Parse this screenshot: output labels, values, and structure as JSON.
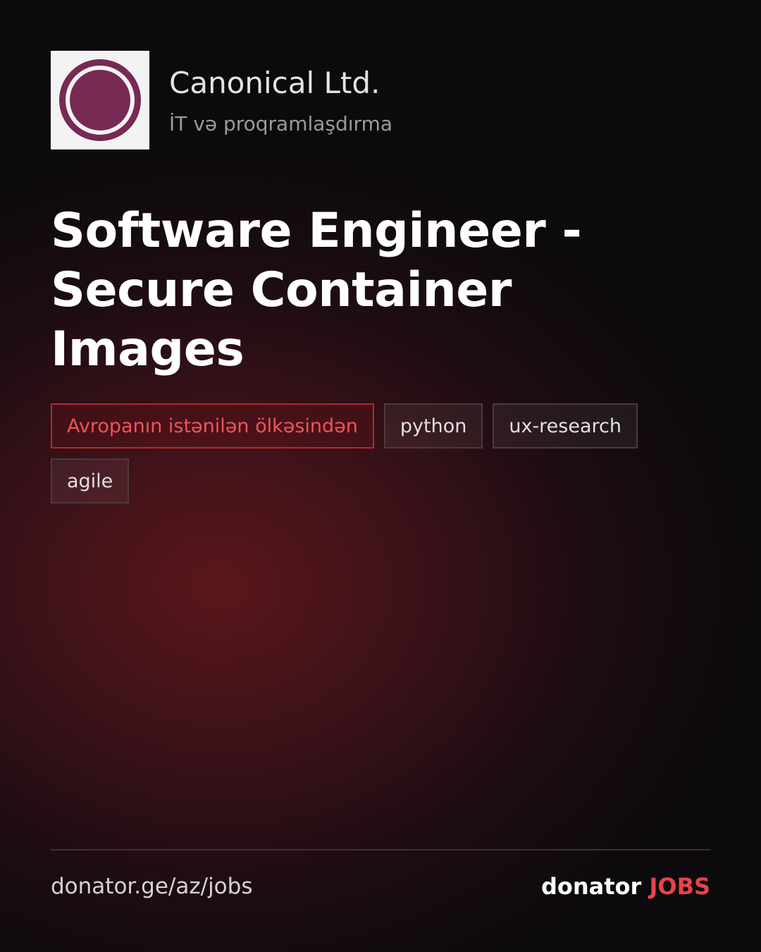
{
  "company": {
    "name": "Canonical Ltd.",
    "category": "İT və proqramlaşdırma",
    "logo_icon": "circle-of-friends-logo-icon",
    "logo_color": "#772953",
    "logo_background": "#f3f3f3"
  },
  "job": {
    "title": "Software Engineer - Secure Container Images"
  },
  "tags": [
    "Avropanın istənilən ölkəsindən",
    "python",
    "ux-research",
    "agile"
  ],
  "footer": {
    "url": "donator.ge/az/jobs",
    "brand_word": "donator",
    "brand_accent": "JOBS"
  },
  "colors": {
    "accent": "#e8434a",
    "location_tag": "#f05458",
    "background_glow": "#5a171a"
  }
}
